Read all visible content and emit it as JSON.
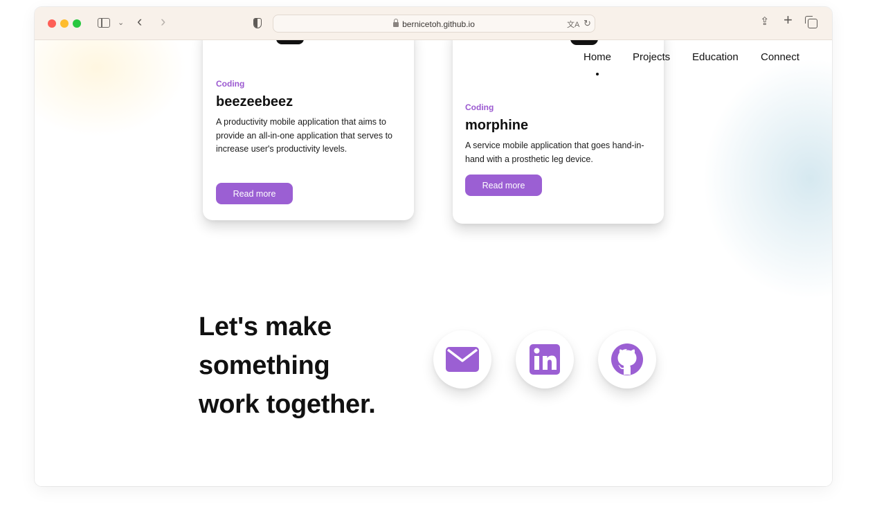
{
  "browser": {
    "url": "bernicetoh.github.io"
  },
  "nav": {
    "items": [
      "Home",
      "Projects",
      "Education",
      "Connect"
    ]
  },
  "projects": [
    {
      "tag": "Coding",
      "title": "beezeebeez",
      "description": "A productivity mobile application that aims to provide an all-in-one application that serves to increase user's productivity levels.",
      "button": "Read more"
    },
    {
      "tag": "Coding",
      "title": "morphine",
      "description": "A service mobile application that goes hand-in-hand with a prosthetic leg device.",
      "button": "Read more"
    }
  ],
  "cta": {
    "lines": [
      "Let's make",
      "something",
      "work together."
    ]
  },
  "social": [
    "mail-icon",
    "linkedin-icon",
    "github-icon"
  ],
  "colors": {
    "accent": "#9b5fd3",
    "toolbar": "#f8f1ea"
  }
}
